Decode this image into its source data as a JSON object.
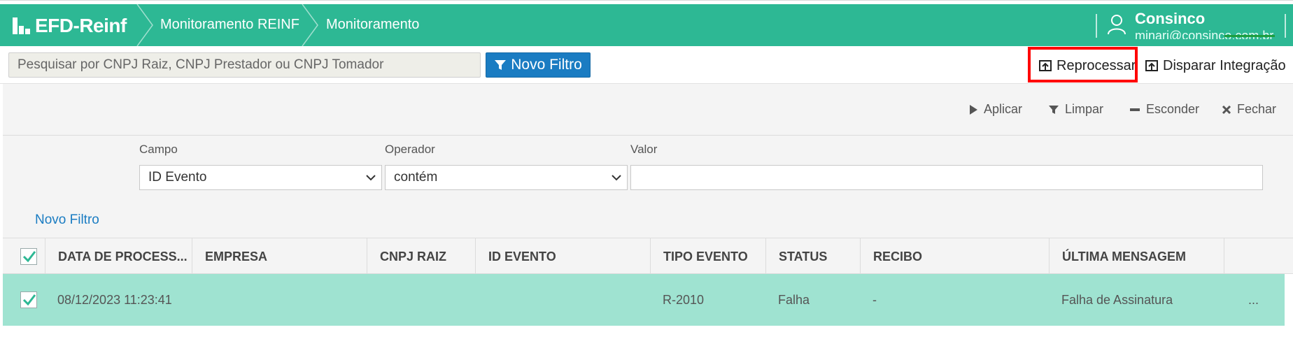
{
  "header": {
    "logo_text": "EFD-Reinf",
    "breadcrumbs": [
      "Monitoramento REINF",
      "Monitoramento"
    ],
    "user_name": "Consinco",
    "user_email": "minari@consinco.com.br"
  },
  "toolbar": {
    "search_placeholder": "Pesquisar por CNPJ Raiz, CNPJ Prestador ou CNPJ Tomador",
    "novo_filtro_label": "Novo Filtro",
    "reprocessar_label": "Reprocessar",
    "disparar_label": "Disparar Integração"
  },
  "filter": {
    "actions": {
      "aplicar": "Aplicar",
      "limpar": "Limpar",
      "esconder": "Esconder",
      "fechar": "Fechar"
    },
    "labels": {
      "campo": "Campo",
      "operador": "Operador",
      "valor": "Valor"
    },
    "campo_value": "ID Evento",
    "operador_value": "contém",
    "valor_value": "",
    "novo_filtro_link": "Novo Filtro"
  },
  "table": {
    "columns": [
      "DATA DE PROCESS...",
      "EMPRESA",
      "CNPJ RAIZ",
      "ID EVENTO",
      "TIPO EVENTO",
      "STATUS",
      "RECIBO",
      "ÚLTIMA MENSAGEM"
    ],
    "rows": [
      {
        "data": "08/12/2023 11:23:41",
        "empresa": "",
        "cnpj_raiz": "",
        "id_evento": "",
        "tipo_evento": "R-2010",
        "status": "Falha",
        "recibo": "-",
        "ultima_mensagem": "Falha de Assinatura",
        "more": "..."
      }
    ]
  },
  "colors": {
    "header_bg": "#2db894",
    "primary_button": "#1a7cc2",
    "selected_row": "#9fe3d1",
    "highlight_box": "#ff0000"
  }
}
